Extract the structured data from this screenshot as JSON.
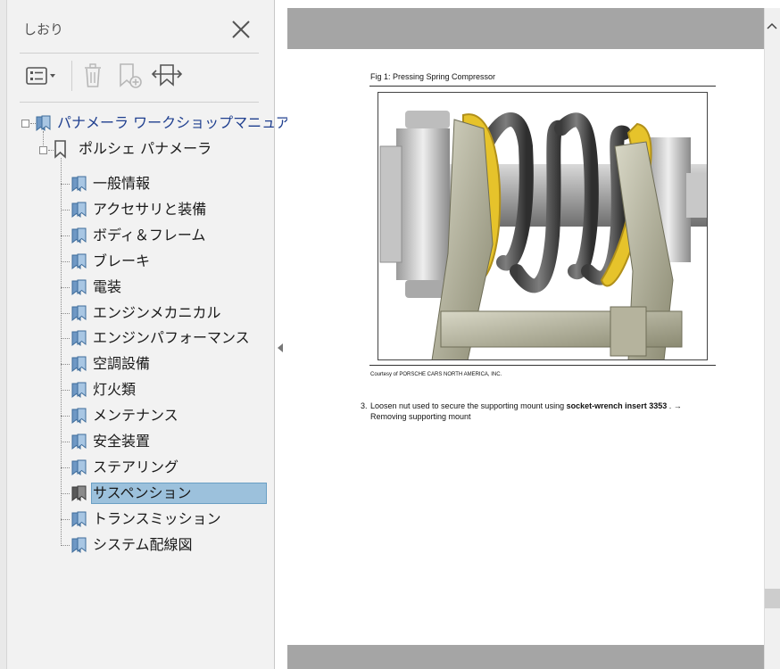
{
  "panel": {
    "title": "しおり"
  },
  "bookmarks": {
    "root": "パナメーラ ワークショップマニュアル",
    "child": "ポルシェ パナメーラ",
    "items": [
      "一般情報",
      "アクセサリと装備",
      "ボディ＆フレーム",
      "ブレーキ",
      "電装",
      "エンジンメカニカル",
      "エンジンパフォーマンス",
      "空調設備",
      "灯火類",
      "メンテナンス",
      "安全装置",
      "ステアリング",
      "サスペンション",
      "トランスミッション",
      "システム配線図"
    ],
    "selected": "サスペンション"
  },
  "document": {
    "fig_caption": "Fig 1: Pressing Spring Compressor",
    "courtesy": "Courtesy of PORSCHE CARS NORTH AMERICA, INC.",
    "step_number": "3.",
    "step_text_pre": "Loosen nut used to secure the supporting mount using ",
    "step_text_bold": "socket-wrench insert 3353",
    "step_text_post": " . →",
    "step_line2": "Removing supporting mount"
  },
  "colors": {
    "selection": "#9cc1dc",
    "root_label": "#1f3f8f",
    "doc_background": "#a5a5a5"
  }
}
